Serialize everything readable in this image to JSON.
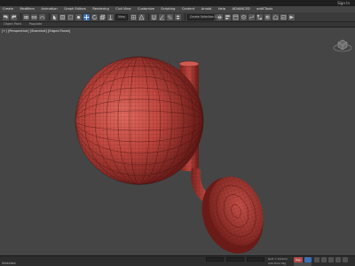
{
  "header": {
    "sign_in": "Sign In"
  },
  "menu": [
    "Create",
    "Modifiers",
    "Animation",
    "Graph Editors",
    "Rendering",
    "Civil View",
    "Customize",
    "Scripting",
    "Content",
    "Arnold",
    "Help",
    "ADVANCED",
    "addCTools"
  ],
  "toolbar": {
    "view_dropdown": "View",
    "selection_set": "Create Selection Set"
  },
  "ribbon_tabs": [
    "Object Paint",
    "Populate"
  ],
  "viewport": {
    "label": "[+] [Perspective] [Standard] [Edged Faces]",
    "model_color": "#c0473f"
  },
  "status": {
    "left_text": "Selected",
    "grid_text": "Grid = 10.0cm",
    "add_time_tag": "Add Time Tag",
    "key_label": "Key"
  }
}
